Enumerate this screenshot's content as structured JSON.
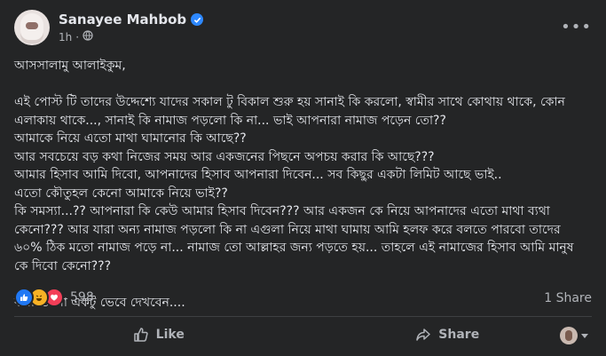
{
  "author": {
    "name": "Sanayee Mahbob",
    "time": "1h",
    "dot": "·"
  },
  "post": {
    "lines": [
      "আসসালামু আলাইকুম,",
      "",
      "এই পোস্ট টি তাদের উদ্দেশ্যে যাদের সকাল টু বিকাল শুরু হয় সানাই কি করলো, স্বামীর সাথে কোথায় থাকে, কোন এলাকায় থাকে..., সানাই কি নামাজ পড়লো কি না... ভাই আপনারা নামাজ পড়েন তো??",
      "আমাকে নিয়ে এতো মাথা ঘামানোর কি আছে??",
      "আর সবচেয়ে বড় কথা নিজের সময় আর একজনের পিছনে অপচয় করার কি আছে???",
      " আমার হিসাব আমি দিবো, আপনাদের হিসাব আপনারা দিবেন... সব কিছুর একটা লিমিট আছে ভাই..",
      "এতো কৌতুহল কেনো আমাকে নিয়ে ভাই??",
      "কি সমস্যা...?? আপনারা কি কেউ আমার হিসাব দিবেন??? আর একজন কে নিয়ে আপনাদের এতো মাথা ব্যথা কেনো??? আর যারা অন্য নামাজ পড়লো কি না এগুলা নিয়ে মাথা ঘামায় আমি হলফ করে বলতে পারবো তাদের ৬০% ঠিক মতো নামাজ পড়ে না... নামাজ তো আল্লাহর জন্য পড়তে হয়... তাহলে এই নামাজের হিসাব আমি মানুষ কে দিবো কেনো???",
      "",
      "কথা গুলো একটু ভেবে দেখবেন...."
    ]
  },
  "stats": {
    "reaction_count": "598",
    "shares": "1 Share"
  },
  "actions": {
    "like": "Like",
    "share": "Share"
  },
  "icons": {
    "verified": "verified-badge-icon",
    "audience": "globe-icon",
    "more": "more-options-icon",
    "like_reaction": "like-reaction-icon",
    "haha_reaction": "haha-reaction-icon",
    "love_reaction": "love-reaction-icon"
  },
  "colors": {
    "background": "#242526",
    "text": "#e4e6eb",
    "secondary": "#b0b3b8",
    "accent": "#2d88ff"
  }
}
